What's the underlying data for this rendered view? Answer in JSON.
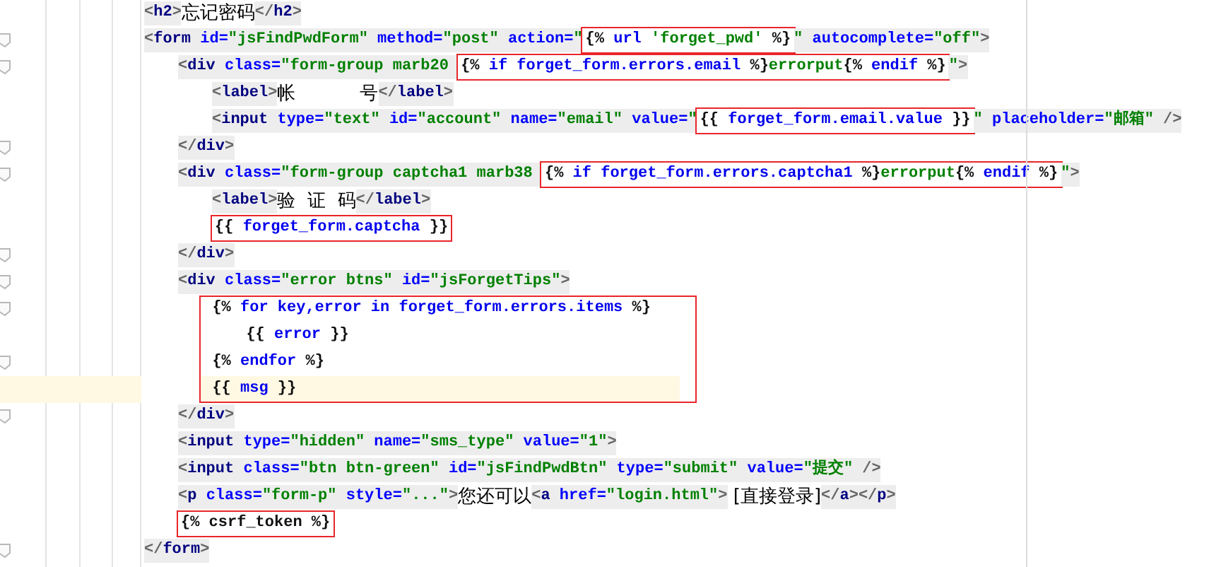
{
  "editor": {
    "lines": [
      {
        "kind": "line",
        "tokens": [
          {
            "kind": "punct",
            "text": "<"
          },
          {
            "kind": "tag",
            "text": "h2"
          },
          {
            "kind": "punct",
            "text": ">"
          },
          {
            "kind": "text",
            "text": "忘记密码"
          },
          {
            "kind": "punct",
            "text": "</"
          },
          {
            "kind": "tag",
            "text": "h2"
          },
          {
            "kind": "punct",
            "text": ">"
          }
        ]
      },
      {
        "kind": "line",
        "fold": true,
        "tokens": [
          {
            "kind": "punct",
            "text": "<"
          },
          {
            "kind": "tag",
            "text": "form"
          },
          {
            "kind": "attr",
            "text": " id="
          },
          {
            "kind": "str",
            "text": "\"jsFindPwdForm\""
          },
          {
            "kind": "attr",
            "text": " method="
          },
          {
            "kind": "str",
            "text": "\"post\""
          },
          {
            "kind": "attr",
            "text": " action="
          },
          {
            "kind": "str",
            "text": "\""
          },
          {
            "kind": "box",
            "tokens": [
              {
                "kind": "delim",
                "text": "{% "
              },
              {
                "kind": "keyword",
                "text": "url "
              },
              {
                "kind": "str",
                "text": "'forget_pwd' "
              },
              {
                "kind": "delim",
                "text": "%}"
              }
            ]
          },
          {
            "kind": "str",
            "text": "\""
          },
          {
            "kind": "attr",
            "text": " autocomplete="
          },
          {
            "kind": "str",
            "text": "\"off\""
          },
          {
            "kind": "punct",
            "text": ">"
          }
        ],
        "children": [
          {
            "kind": "line",
            "fold": true,
            "tokens": [
              {
                "kind": "punct",
                "text": "<"
              },
              {
                "kind": "tag",
                "text": "div"
              },
              {
                "kind": "attr",
                "text": " class="
              },
              {
                "kind": "str",
                "text": "\"form-group marb20 "
              },
              {
                "kind": "box",
                "tokens": [
                  {
                    "kind": "delim",
                    "text": "{% "
                  },
                  {
                    "kind": "keyword",
                    "text": "if forget_form.errors.email "
                  },
                  {
                    "kind": "delim",
                    "text": "%}"
                  },
                  {
                    "kind": "str",
                    "text": "errorput"
                  },
                  {
                    "kind": "delim",
                    "text": "{% "
                  },
                  {
                    "kind": "keyword",
                    "text": "endif "
                  },
                  {
                    "kind": "delim",
                    "text": "%}"
                  }
                ]
              },
              {
                "kind": "str",
                "text": "\""
              },
              {
                "kind": "punct",
                "text": ">"
              }
            ],
            "children": [
              {
                "kind": "line",
                "tokens": [
                  {
                    "kind": "punct",
                    "text": "<"
                  },
                  {
                    "kind": "tag",
                    "text": "label"
                  },
                  {
                    "kind": "punct",
                    "text": ">"
                  },
                  {
                    "kind": "text",
                    "text": "帐           号"
                  },
                  {
                    "kind": "punct",
                    "text": "</"
                  },
                  {
                    "kind": "tag",
                    "text": "label"
                  },
                  {
                    "kind": "punct",
                    "text": ">"
                  }
                ]
              },
              {
                "kind": "line",
                "tokens": [
                  {
                    "kind": "punct",
                    "text": "<"
                  },
                  {
                    "kind": "tag",
                    "text": "input"
                  },
                  {
                    "kind": "attr",
                    "text": " type="
                  },
                  {
                    "kind": "str",
                    "text": "\"text\""
                  },
                  {
                    "kind": "attr",
                    "text": " id="
                  },
                  {
                    "kind": "str",
                    "text": "\"account\""
                  },
                  {
                    "kind": "attr",
                    "text": " name="
                  },
                  {
                    "kind": "str",
                    "text": "\"email\""
                  },
                  {
                    "kind": "attr",
                    "text": " value="
                  },
                  {
                    "kind": "str",
                    "text": "\""
                  },
                  {
                    "kind": "box",
                    "tokens": [
                      {
                        "kind": "delim",
                        "text": "{{ "
                      },
                      {
                        "kind": "keyword",
                        "text": "forget_form.email.value "
                      },
                      {
                        "kind": "delim",
                        "text": "}}"
                      }
                    ]
                  },
                  {
                    "kind": "str",
                    "text": "\""
                  },
                  {
                    "kind": "attr",
                    "text": " placeholder="
                  },
                  {
                    "kind": "str",
                    "text": "\"邮箱\""
                  },
                  {
                    "kind": "punct",
                    "text": " />"
                  }
                ]
              }
            ]
          },
          {
            "kind": "line",
            "fold": true,
            "tokens": [
              {
                "kind": "punct",
                "text": "</"
              },
              {
                "kind": "tag",
                "text": "div"
              },
              {
                "kind": "punct",
                "text": ">"
              }
            ]
          },
          {
            "kind": "line",
            "fold": true,
            "tokens": [
              {
                "kind": "punct",
                "text": "<"
              },
              {
                "kind": "tag",
                "text": "div"
              },
              {
                "kind": "attr",
                "text": " class="
              },
              {
                "kind": "str",
                "text": "\"form-group captcha1 marb38 "
              },
              {
                "kind": "box",
                "tokens": [
                  {
                    "kind": "delim",
                    "text": "{% "
                  },
                  {
                    "kind": "keyword",
                    "text": "if forget_form.errors.captcha1 "
                  },
                  {
                    "kind": "delim",
                    "text": "%}"
                  },
                  {
                    "kind": "str",
                    "text": "errorput"
                  },
                  {
                    "kind": "delim",
                    "text": "{% "
                  },
                  {
                    "kind": "keyword",
                    "text": "endif "
                  },
                  {
                    "kind": "delim",
                    "text": "%}"
                  }
                ]
              },
              {
                "kind": "str",
                "text": "\""
              },
              {
                "kind": "punct",
                "text": ">"
              }
            ],
            "children": [
              {
                "kind": "line",
                "tokens": [
                  {
                    "kind": "punct",
                    "text": "<"
                  },
                  {
                    "kind": "tag",
                    "text": "label"
                  },
                  {
                    "kind": "punct",
                    "text": ">"
                  },
                  {
                    "kind": "text",
                    "text": "验  证  码"
                  },
                  {
                    "kind": "punct",
                    "text": "</"
                  },
                  {
                    "kind": "tag",
                    "text": "label"
                  },
                  {
                    "kind": "punct",
                    "text": ">"
                  }
                ]
              },
              {
                "kind": "line",
                "tokens": [
                  {
                    "kind": "box",
                    "tokens": [
                      {
                        "kind": "delim",
                        "text": "{{ "
                      },
                      {
                        "kind": "keyword",
                        "text": "forget_form.captcha "
                      },
                      {
                        "kind": "delim",
                        "text": "}}"
                      }
                    ]
                  }
                ]
              }
            ]
          },
          {
            "kind": "line",
            "fold": true,
            "tokens": [
              {
                "kind": "punct",
                "text": "</"
              },
              {
                "kind": "tag",
                "text": "div"
              },
              {
                "kind": "punct",
                "text": ">"
              }
            ]
          },
          {
            "kind": "line",
            "fold": true,
            "tokens": [
              {
                "kind": "punct",
                "text": "<"
              },
              {
                "kind": "tag",
                "text": "div"
              },
              {
                "kind": "attr",
                "text": " class="
              },
              {
                "kind": "str",
                "text": "\"error btns\""
              },
              {
                "kind": "attr",
                "text": " id="
              },
              {
                "kind": "str",
                "text": "\"jsForgetTips\""
              },
              {
                "kind": "punct",
                "text": ">"
              }
            ],
            "children": [
              {
                "kind": "box",
                "children": [
                  {
                    "kind": "line",
                    "fold": true,
                    "tokens": [
                      {
                        "kind": "delim",
                        "text": "{% "
                      },
                      {
                        "kind": "keyword",
                        "text": "for key,error in forget_form.errors.items "
                      },
                      {
                        "kind": "delim",
                        "text": "%}"
                      }
                    ],
                    "children": [
                      {
                        "kind": "line",
                        "tokens": [
                          {
                            "kind": "delim",
                            "text": "{{ "
                          },
                          {
                            "kind": "keyword",
                            "text": "error "
                          },
                          {
                            "kind": "delim",
                            "text": "}}"
                          }
                        ]
                      }
                    ]
                  },
                  {
                    "kind": "line",
                    "fold": true,
                    "tokens": [
                      {
                        "kind": "delim",
                        "text": "{% "
                      },
                      {
                        "kind": "keyword",
                        "text": "endfor "
                      },
                      {
                        "kind": "delim",
                        "text": "%}"
                      }
                    ]
                  },
                  {
                    "kind": "line",
                    "current": true,
                    "tokens": [
                      {
                        "kind": "delim",
                        "text": "{{ "
                      },
                      {
                        "kind": "keyword",
                        "text": "msg "
                      },
                      {
                        "kind": "delim",
                        "text": "}}"
                      }
                    ]
                  }
                ]
              }
            ]
          },
          {
            "kind": "line",
            "fold": true,
            "tokens": [
              {
                "kind": "punct",
                "text": "</"
              },
              {
                "kind": "tag",
                "text": "div"
              },
              {
                "kind": "punct",
                "text": ">"
              }
            ]
          },
          {
            "kind": "line",
            "tokens": [
              {
                "kind": "punct",
                "text": "<"
              },
              {
                "kind": "tag",
                "text": "input"
              },
              {
                "kind": "attr",
                "text": " type="
              },
              {
                "kind": "str",
                "text": "\"hidden\""
              },
              {
                "kind": "attr",
                "text": " name="
              },
              {
                "kind": "str",
                "text": "\"sms_type\""
              },
              {
                "kind": "attr",
                "text": " value="
              },
              {
                "kind": "str",
                "text": "\"1\""
              },
              {
                "kind": "punct",
                "text": ">"
              }
            ]
          },
          {
            "kind": "line",
            "tokens": [
              {
                "kind": "punct",
                "text": "<"
              },
              {
                "kind": "tag",
                "text": "input"
              },
              {
                "kind": "attr",
                "text": " class="
              },
              {
                "kind": "str",
                "text": "\"btn btn-green\""
              },
              {
                "kind": "attr",
                "text": " id="
              },
              {
                "kind": "str",
                "text": "\"jsFindPwdBtn\""
              },
              {
                "kind": "attr",
                "text": " type="
              },
              {
                "kind": "str",
                "text": "\"submit\""
              },
              {
                "kind": "attr",
                "text": " value="
              },
              {
                "kind": "str",
                "text": "\"提交\""
              },
              {
                "kind": "punct",
                "text": " />"
              }
            ]
          },
          {
            "kind": "line",
            "tokens": [
              {
                "kind": "punct",
                "text": "<"
              },
              {
                "kind": "tag",
                "text": "p"
              },
              {
                "kind": "attr",
                "text": " class="
              },
              {
                "kind": "str",
                "text": "\"form-p\""
              },
              {
                "kind": "attr",
                "text": " style="
              },
              {
                "kind": "str",
                "text": "\"...\""
              },
              {
                "kind": "punct",
                "text": ">"
              },
              {
                "kind": "text",
                "text": "您还可以"
              },
              {
                "kind": "punct",
                "text": "<"
              },
              {
                "kind": "tag",
                "text": "a"
              },
              {
                "kind": "attr",
                "text": " href="
              },
              {
                "kind": "str",
                "text": "\"login.html\""
              },
              {
                "kind": "punct",
                "text": ">"
              },
              {
                "kind": "text",
                "text": " [直接登录]"
              },
              {
                "kind": "punct",
                "text": "</"
              },
              {
                "kind": "tag",
                "text": "a"
              },
              {
                "kind": "punct",
                "text": "></"
              },
              {
                "kind": "tag",
                "text": "p"
              },
              {
                "kind": "punct",
                "text": ">"
              }
            ]
          },
          {
            "kind": "line",
            "tokens": [
              {
                "kind": "box",
                "tokens": [
                  {
                    "kind": "delim",
                    "text": "{% csrf_token %}"
                  }
                ]
              }
            ]
          }
        ]
      },
      {
        "kind": "line",
        "fold": true,
        "tokens": [
          {
            "kind": "punct",
            "text": "</"
          },
          {
            "kind": "tag",
            "text": "form"
          },
          {
            "kind": "punct",
            "text": ">"
          }
        ]
      }
    ]
  }
}
